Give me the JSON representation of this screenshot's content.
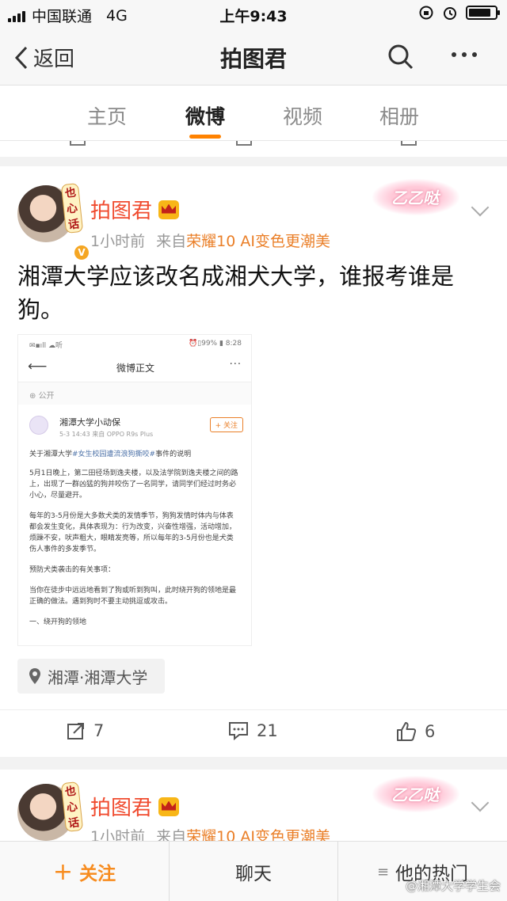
{
  "status_bar": {
    "carrier": "中国联通",
    "network": "4G",
    "time": "上午9:43",
    "battery_level": 0.85
  },
  "nav": {
    "back_label": "返回",
    "title": "拍图君"
  },
  "tabs": [
    {
      "label": "主页",
      "active": false
    },
    {
      "label": "微博",
      "active": true
    },
    {
      "label": "视频",
      "active": false
    },
    {
      "label": "相册",
      "active": false
    }
  ],
  "accent_color": "#ff8200",
  "post": {
    "avatar_label": "也心话",
    "author": "拍图君",
    "time": "1小时前",
    "source_prefix": "来自",
    "source": "荣耀10 AI变色更潮美",
    "decor_text": "乙乙哒",
    "text": "湘潭大学应该改名成湘犬大学，谁报考谁是狗。",
    "location": "湘潭·湘潭大学",
    "repost_count": "7",
    "comment_count": "21",
    "like_count": "6"
  },
  "embedded": {
    "status_left": "✉▪ıll ☁听",
    "status_right": "⏰▯99% ▮ 8:28",
    "title": "微博正文",
    "visibility": "公开",
    "account": "湘潭大学小动保",
    "time": "5-3 14:43  来自 OPPO R9s Plus",
    "follow": "+ 关注",
    "intro_prefix": "关于湘潭大学",
    "intro_tag": "#女生校园遭流浪狗撕咬#",
    "intro_suffix": "事件的说明",
    "p1": "5月1日晚上，第二田径场到逸夫楼，以及法学院到逸夫楼之间的路上，出现了一群凶猛的狗并咬伤了一名同学，请同学们经过时务必小心，尽量避开。",
    "p2": "每年的3-5月份是大多数犬类的发情季节，狗狗发情时体内与体表都会发生变化，具体表现为：行为改变，兴奋性增强，活动增加，烦躁不安，吠声粗大，眼睛发亮等，所以每年的3-5月份也是犬类伤人事件的多发季节。",
    "p3": "预防犬类袭击的有关事项：",
    "p4": "当你在徒步中远远地看到了狗或听到狗叫，此时绕开狗的领地是最正确的做法。遇到狗时不要主动挑逗或攻击。",
    "p5": "一、绕开狗的领地"
  },
  "post2": {
    "avatar_label": "也心话",
    "author": "拍图君",
    "time": "1小时前",
    "source_prefix": "来自",
    "source": "荣耀10 AI变色更潮美",
    "decor_text": "乙乙哒"
  },
  "bottom_bar": {
    "follow": "关注",
    "chat": "聊天",
    "hot": "他的热门"
  },
  "watermark": "@湘潭大学学生会"
}
